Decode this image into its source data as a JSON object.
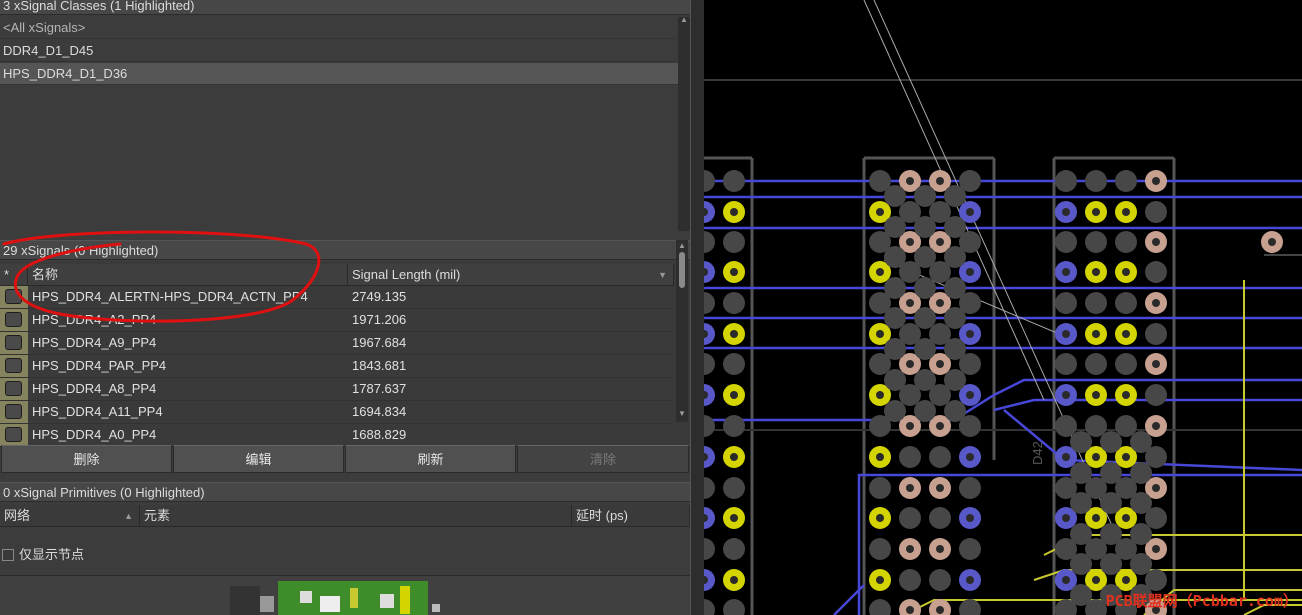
{
  "classes_panel": {
    "header": "3 xSignal Classes (1 Highlighted)",
    "items": [
      {
        "label": "<All xSignals>"
      },
      {
        "label": "DDR4_D1_D45"
      },
      {
        "label": "HPS_DDR4_D1_D36"
      }
    ]
  },
  "signals_panel": {
    "header": "29 xSignals (0 Highlighted)",
    "columns": {
      "star": "*",
      "name": "名称",
      "length": "Signal Length (mil)"
    },
    "rows": [
      {
        "name": "HPS_DDR4_ALERTN-HPS_DDR4_ACTN_PP4",
        "length": "2749.135"
      },
      {
        "name": "HPS_DDR4_A2_PP4",
        "length": "1971.206"
      },
      {
        "name": "HPS_DDR4_A9_PP4",
        "length": "1967.684"
      },
      {
        "name": "HPS_DDR4_PAR_PP4",
        "length": "1843.681"
      },
      {
        "name": "HPS_DDR4_A8_PP4",
        "length": "1787.637"
      },
      {
        "name": "HPS_DDR4_A11_PP4",
        "length": "1694.834"
      },
      {
        "name": "HPS_DDR4_A0_PP4",
        "length": "1688.829"
      }
    ],
    "buttons": {
      "delete": "删除",
      "edit": "编辑",
      "refresh": "刷新",
      "clear": "清除"
    }
  },
  "primitives_panel": {
    "header": "0 xSignal Primitives (0 Highlighted)",
    "columns": {
      "net": "网络",
      "element": "元素",
      "delay": "延时 (ps)"
    },
    "checkbox_label": "仅显示节点"
  },
  "pcb_view": {
    "component_label": "D42",
    "watermark": "PCB联盟网（Pcbbar.com）",
    "colors": {
      "background": "#000000",
      "trace_blue": "#4848d8",
      "trace_yellow": "#c8c830",
      "pad_gray": "#474747",
      "via_yellow": "#d4d400",
      "via_pink": "#c8a090"
    }
  },
  "annotation": {
    "color": "#e01010"
  }
}
